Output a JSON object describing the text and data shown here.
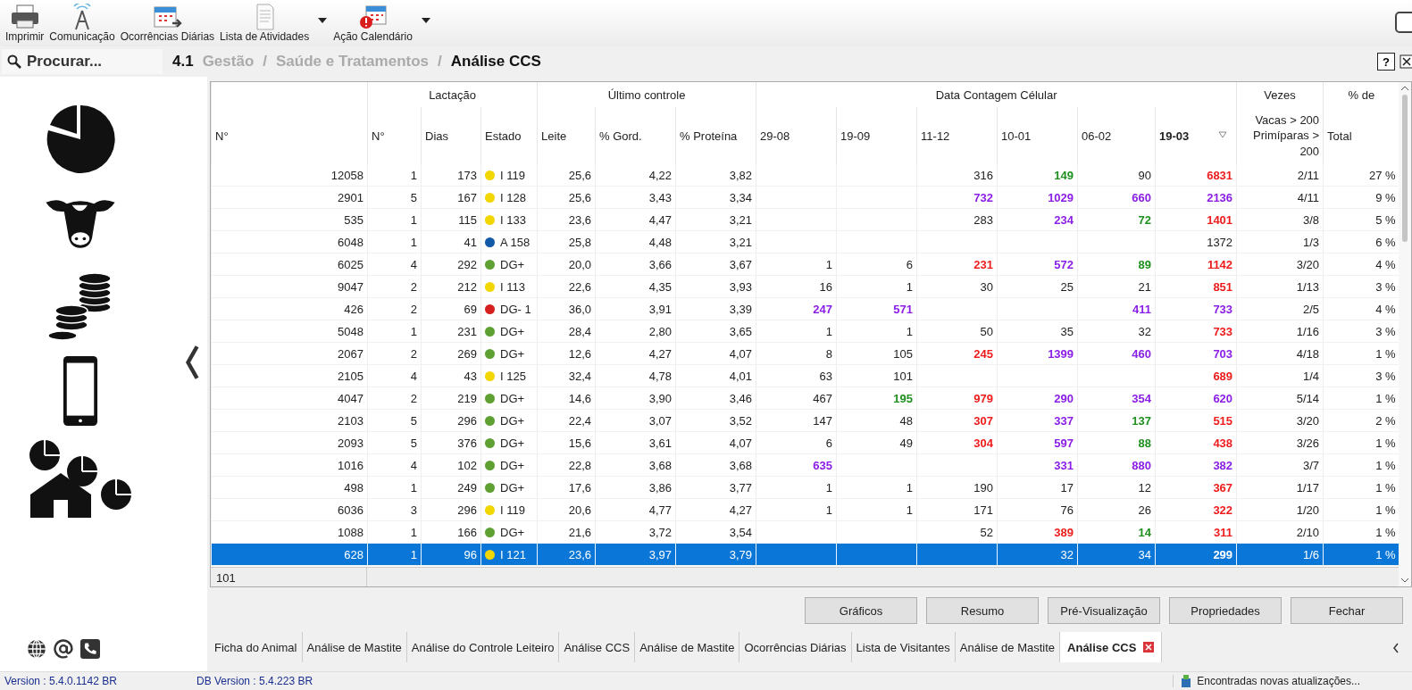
{
  "toolbar": {
    "items": [
      {
        "kind": "printer",
        "label": "Imprimir",
        "dropdown": false
      },
      {
        "kind": "antenna",
        "label": "Comunicação",
        "dropdown": false
      },
      {
        "kind": "calendar-arrow",
        "label": "Ocorrências Diárias",
        "dropdown": false
      },
      {
        "kind": "document",
        "label": "Lista de Atividades",
        "dropdown": true
      },
      {
        "kind": "calendar-alert",
        "label": "Ação Calendário",
        "dropdown": true
      }
    ]
  },
  "search": {
    "placeholder": "Procurar..."
  },
  "breadcrumb": {
    "number": "4.1",
    "items": [
      {
        "label": "Gestão",
        "current": false
      },
      {
        "label": "Saúde e Tratamentos",
        "current": false
      },
      {
        "label": "Análise CCS",
        "current": true
      }
    ],
    "separator": "/",
    "help": "?"
  },
  "sidebar": {
    "items": [
      {
        "kind": "pie"
      },
      {
        "kind": "cow"
      },
      {
        "kind": "coins"
      },
      {
        "kind": "phone"
      },
      {
        "kind": "farm"
      }
    ],
    "bottom_icons": [
      {
        "kind": "globe"
      },
      {
        "kind": "at"
      },
      {
        "kind": "phone"
      }
    ]
  },
  "table": {
    "groups": [
      "Lactação",
      "Último controle",
      "Data Contagem Célular",
      "Vezes",
      "% de"
    ],
    "columns": [
      {
        "label": "N°",
        "sorted": false
      },
      {
        "label": "N°",
        "sorted": false
      },
      {
        "label": "Dias",
        "sorted": false
      },
      {
        "label": "Estado",
        "sorted": false
      },
      {
        "label": "Leite",
        "sorted": false
      },
      {
        "label": "% Gord.",
        "sorted": false
      },
      {
        "label": "% Proteína",
        "sorted": false
      },
      {
        "label": "29-08",
        "sorted": false
      },
      {
        "label": "19-09",
        "sorted": false
      },
      {
        "label": "11-12",
        "sorted": false
      },
      {
        "label": "10-01",
        "sorted": false
      },
      {
        "label": "06-02",
        "sorted": false
      },
      {
        "label": "19-03",
        "sorted": true
      },
      {
        "label": "Vacas > 200 Primíparas > 200",
        "sorted": false
      },
      {
        "label": "Total",
        "sorted": false
      }
    ],
    "rows": [
      {
        "id": "12058",
        "lact": "1",
        "dias": "173",
        "estado": {
          "color": "#f2d600",
          "text": "I 119"
        },
        "leite": "25,6",
        "gord": "4,22",
        "prot": "3,82",
        "counts": {
          "d3": {
            "value": "316",
            "color": "#222222"
          },
          "d4": {
            "value": "149",
            "color": "#1f8f1f"
          },
          "d5": {
            "value": "90",
            "color": "#222222"
          },
          "d6": {
            "value": "6831",
            "color": "#ee1c1c"
          }
        },
        "vezes": "2/11",
        "pct": "27 %",
        "selected": false
      },
      {
        "id": "2901",
        "lact": "5",
        "dias": "167",
        "estado": {
          "color": "#f2d600",
          "text": "I 128"
        },
        "leite": "25,6",
        "gord": "3,43",
        "prot": "3,34",
        "counts": {
          "d3": {
            "value": "732",
            "color": "#8a1ee6"
          },
          "d4": {
            "value": "1029",
            "color": "#8a1ee6"
          },
          "d5": {
            "value": "660",
            "color": "#8a1ee6"
          },
          "d6": {
            "value": "2136",
            "color": "#8a1ee6"
          }
        },
        "vezes": "4/11",
        "pct": "9 %",
        "selected": false
      },
      {
        "id": "535",
        "lact": "1",
        "dias": "115",
        "estado": {
          "color": "#f2d600",
          "text": "I 133"
        },
        "leite": "23,6",
        "gord": "4,47",
        "prot": "3,21",
        "counts": {
          "d3": {
            "value": "283",
            "color": "#222222"
          },
          "d4": {
            "value": "234",
            "color": "#8a1ee6"
          },
          "d5": {
            "value": "72",
            "color": "#1f8f1f"
          },
          "d6": {
            "value": "1401",
            "color": "#ee1c1c"
          }
        },
        "vezes": "3/8",
        "pct": "5 %",
        "selected": false
      },
      {
        "id": "6048",
        "lact": "1",
        "dias": "41",
        "estado": {
          "color": "#1259a8",
          "text": "A 158"
        },
        "leite": "25,8",
        "gord": "4,48",
        "prot": "3,21",
        "counts": {
          "d6": {
            "value": "1372",
            "color": "#222222"
          }
        },
        "vezes": "1/3",
        "pct": "6 %",
        "selected": false
      },
      {
        "id": "6025",
        "lact": "4",
        "dias": "292",
        "estado": {
          "color": "#5ea032",
          "text": "DG+"
        },
        "leite": "20,0",
        "gord": "3,66",
        "prot": "3,67",
        "counts": {
          "d1": {
            "value": "1",
            "color": "#222222"
          },
          "d2": {
            "value": "6",
            "color": "#222222"
          },
          "d3": {
            "value": "231",
            "color": "#ee1c1c"
          },
          "d4": {
            "value": "572",
            "color": "#8a1ee6"
          },
          "d5": {
            "value": "89",
            "color": "#1f8f1f"
          },
          "d6": {
            "value": "1142",
            "color": "#ee1c1c"
          }
        },
        "vezes": "3/20",
        "pct": "4 %",
        "selected": false
      },
      {
        "id": "9047",
        "lact": "2",
        "dias": "212",
        "estado": {
          "color": "#f2d600",
          "text": "I 113"
        },
        "leite": "22,6",
        "gord": "4,35",
        "prot": "3,93",
        "counts": {
          "d1": {
            "value": "16",
            "color": "#222222"
          },
          "d2": {
            "value": "1",
            "color": "#222222"
          },
          "d3": {
            "value": "30",
            "color": "#222222"
          },
          "d4": {
            "value": "25",
            "color": "#222222"
          },
          "d5": {
            "value": "21",
            "color": "#222222"
          },
          "d6": {
            "value": "851",
            "color": "#ee1c1c"
          }
        },
        "vezes": "1/13",
        "pct": "3 %",
        "selected": false
      },
      {
        "id": "426",
        "lact": "2",
        "dias": "69",
        "estado": {
          "color": "#d62020",
          "text": "DG- 1"
        },
        "leite": "36,0",
        "gord": "3,91",
        "prot": "3,39",
        "counts": {
          "d1": {
            "value": "247",
            "color": "#8a1ee6"
          },
          "d2": {
            "value": "571",
            "color": "#8a1ee6"
          },
          "d5": {
            "value": "411",
            "color": "#8a1ee6"
          },
          "d6": {
            "value": "733",
            "color": "#8a1ee6"
          }
        },
        "vezes": "2/5",
        "pct": "4 %",
        "selected": false
      },
      {
        "id": "5048",
        "lact": "1",
        "dias": "231",
        "estado": {
          "color": "#5ea032",
          "text": "DG+"
        },
        "leite": "28,4",
        "gord": "2,80",
        "prot": "3,65",
        "counts": {
          "d1": {
            "value": "1",
            "color": "#222222"
          },
          "d2": {
            "value": "1",
            "color": "#222222"
          },
          "d3": {
            "value": "50",
            "color": "#222222"
          },
          "d4": {
            "value": "35",
            "color": "#222222"
          },
          "d5": {
            "value": "32",
            "color": "#222222"
          },
          "d6": {
            "value": "733",
            "color": "#ee1c1c"
          }
        },
        "vezes": "1/16",
        "pct": "3 %",
        "selected": false
      },
      {
        "id": "2067",
        "lact": "2",
        "dias": "269",
        "estado": {
          "color": "#5ea032",
          "text": "DG+"
        },
        "leite": "12,6",
        "gord": "4,27",
        "prot": "4,07",
        "counts": {
          "d1": {
            "value": "8",
            "color": "#222222"
          },
          "d2": {
            "value": "105",
            "color": "#222222"
          },
          "d3": {
            "value": "245",
            "color": "#ee1c1c"
          },
          "d4": {
            "value": "1399",
            "color": "#8a1ee6"
          },
          "d5": {
            "value": "460",
            "color": "#8a1ee6"
          },
          "d6": {
            "value": "703",
            "color": "#8a1ee6"
          }
        },
        "vezes": "4/18",
        "pct": "1 %",
        "selected": false
      },
      {
        "id": "2105",
        "lact": "4",
        "dias": "43",
        "estado": {
          "color": "#f2d600",
          "text": "I 125"
        },
        "leite": "32,4",
        "gord": "4,78",
        "prot": "4,01",
        "counts": {
          "d1": {
            "value": "63",
            "color": "#222222"
          },
          "d2": {
            "value": "101",
            "color": "#222222"
          },
          "d6": {
            "value": "689",
            "color": "#ee1c1c"
          }
        },
        "vezes": "1/4",
        "pct": "3 %",
        "selected": false
      },
      {
        "id": "4047",
        "lact": "2",
        "dias": "219",
        "estado": {
          "color": "#5ea032",
          "text": "DG+"
        },
        "leite": "14,6",
        "gord": "3,90",
        "prot": "3,46",
        "counts": {
          "d1": {
            "value": "467",
            "color": "#222222"
          },
          "d2": {
            "value": "195",
            "color": "#1f8f1f"
          },
          "d3": {
            "value": "979",
            "color": "#ee1c1c"
          },
          "d4": {
            "value": "290",
            "color": "#8a1ee6"
          },
          "d5": {
            "value": "354",
            "color": "#8a1ee6"
          },
          "d6": {
            "value": "620",
            "color": "#8a1ee6"
          }
        },
        "vezes": "5/14",
        "pct": "1 %",
        "selected": false
      },
      {
        "id": "2103",
        "lact": "5",
        "dias": "296",
        "estado": {
          "color": "#5ea032",
          "text": "DG+"
        },
        "leite": "22,4",
        "gord": "3,07",
        "prot": "3,52",
        "counts": {
          "d1": {
            "value": "147",
            "color": "#222222"
          },
          "d2": {
            "value": "48",
            "color": "#222222"
          },
          "d3": {
            "value": "307",
            "color": "#ee1c1c"
          },
          "d4": {
            "value": "337",
            "color": "#8a1ee6"
          },
          "d5": {
            "value": "137",
            "color": "#1f8f1f"
          },
          "d6": {
            "value": "515",
            "color": "#ee1c1c"
          }
        },
        "vezes": "3/20",
        "pct": "2 %",
        "selected": false
      },
      {
        "id": "2093",
        "lact": "5",
        "dias": "376",
        "estado": {
          "color": "#5ea032",
          "text": "DG+"
        },
        "leite": "15,6",
        "gord": "3,61",
        "prot": "4,07",
        "counts": {
          "d1": {
            "value": "6",
            "color": "#222222"
          },
          "d2": {
            "value": "49",
            "color": "#222222"
          },
          "d3": {
            "value": "304",
            "color": "#ee1c1c"
          },
          "d4": {
            "value": "597",
            "color": "#8a1ee6"
          },
          "d5": {
            "value": "88",
            "color": "#1f8f1f"
          },
          "d6": {
            "value": "438",
            "color": "#ee1c1c"
          }
        },
        "vezes": "3/26",
        "pct": "1 %",
        "selected": false
      },
      {
        "id": "1016",
        "lact": "4",
        "dias": "102",
        "estado": {
          "color": "#5ea032",
          "text": "DG+"
        },
        "leite": "22,8",
        "gord": "3,68",
        "prot": "3,68",
        "counts": {
          "d1": {
            "value": "635",
            "color": "#8a1ee6"
          },
          "d4": {
            "value": "331",
            "color": "#8a1ee6"
          },
          "d5": {
            "value": "880",
            "color": "#8a1ee6"
          },
          "d6": {
            "value": "382",
            "color": "#8a1ee6"
          }
        },
        "vezes": "3/7",
        "pct": "1 %",
        "selected": false
      },
      {
        "id": "498",
        "lact": "1",
        "dias": "249",
        "estado": {
          "color": "#5ea032",
          "text": "DG+"
        },
        "leite": "17,6",
        "gord": "3,86",
        "prot": "3,77",
        "counts": {
          "d1": {
            "value": "1",
            "color": "#222222"
          },
          "d2": {
            "value": "1",
            "color": "#222222"
          },
          "d3": {
            "value": "190",
            "color": "#222222"
          },
          "d4": {
            "value": "17",
            "color": "#222222"
          },
          "d5": {
            "value": "12",
            "color": "#222222"
          },
          "d6": {
            "value": "367",
            "color": "#ee1c1c"
          }
        },
        "vezes": "1/17",
        "pct": "1 %",
        "selected": false
      },
      {
        "id": "6036",
        "lact": "3",
        "dias": "296",
        "estado": {
          "color": "#f2d600",
          "text": "I 119"
        },
        "leite": "20,6",
        "gord": "4,77",
        "prot": "4,27",
        "counts": {
          "d1": {
            "value": "1",
            "color": "#222222"
          },
          "d2": {
            "value": "1",
            "color": "#222222"
          },
          "d3": {
            "value": "171",
            "color": "#222222"
          },
          "d4": {
            "value": "76",
            "color": "#222222"
          },
          "d5": {
            "value": "26",
            "color": "#222222"
          },
          "d6": {
            "value": "322",
            "color": "#ee1c1c"
          }
        },
        "vezes": "1/20",
        "pct": "1 %",
        "selected": false
      },
      {
        "id": "1088",
        "lact": "1",
        "dias": "166",
        "estado": {
          "color": "#5ea032",
          "text": "DG+"
        },
        "leite": "21,6",
        "gord": "3,72",
        "prot": "3,54",
        "counts": {
          "d3": {
            "value": "52",
            "color": "#222222"
          },
          "d4": {
            "value": "389",
            "color": "#ee1c1c"
          },
          "d5": {
            "value": "14",
            "color": "#1f8f1f"
          },
          "d6": {
            "value": "311",
            "color": "#ee1c1c"
          }
        },
        "vezes": "2/10",
        "pct": "1 %",
        "selected": false
      },
      {
        "id": "628",
        "lact": "1",
        "dias": "96",
        "estado": {
          "color": "#f2d600",
          "text": "I 121"
        },
        "leite": "23,6",
        "gord": "3,97",
        "prot": "3,79",
        "counts": {
          "d4": {
            "value": "32",
            "bold": false
          },
          "d5": {
            "value": "34",
            "bold": false
          },
          "d6": {
            "value": "299",
            "bold": true
          }
        },
        "vezes": "1/6",
        "pct": "1 %",
        "selected": true
      }
    ],
    "footer_count": "101"
  },
  "buttons": [
    "Gráficos",
    "Resumo",
    "Pré-Visualização",
    "Propriedades",
    "Fechar"
  ],
  "tabs": [
    {
      "label": "Ficha do Animal",
      "selected": false
    },
    {
      "label": "Análise de Mastite",
      "selected": false
    },
    {
      "label": "Análise do Controle Leiteiro",
      "selected": false
    },
    {
      "label": "Análise CCS",
      "selected": false
    },
    {
      "label": "Análise de Mastite",
      "selected": false
    },
    {
      "label": "Ocorrências Diárias",
      "selected": false
    },
    {
      "label": "Lista de Visitantes",
      "selected": false
    },
    {
      "label": "Análise de Mastite",
      "selected": false
    },
    {
      "label": "Análise CCS",
      "selected": true
    }
  ],
  "status_bar": {
    "version": "Version : 5.4.0.1142 BR",
    "db_version": "DB Version : 5.4.223 BR",
    "notice": "Encontradas novas atualizações..."
  }
}
